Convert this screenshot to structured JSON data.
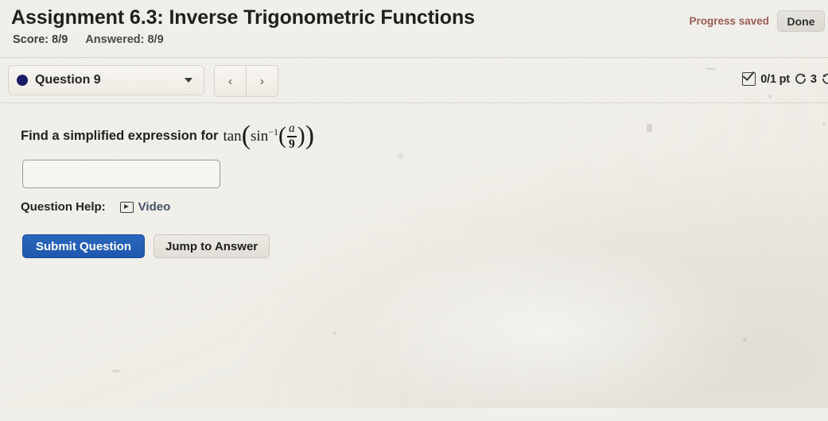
{
  "header": {
    "title": "Assignment 6.3: Inverse Trigonometric Functions",
    "score_label": "Score: 8/9",
    "answered_label": "Answered: 8/9",
    "progress_saved": "Progress saved",
    "done_label": "Done",
    "progress_saved_color": "#9a5b57"
  },
  "question_bar": {
    "selected_question": "Question 9",
    "status_dot_color": "#1b1c66",
    "dropdown_caret_icon": "chevron-down-icon",
    "prev_label": "‹",
    "next_label": "›",
    "points": "0/1 pt",
    "attempts": "3",
    "check_icon": "checkbox-checked-icon",
    "retry_icon": "circular-arrow-icon",
    "details_icon": "circular-arrow-icon"
  },
  "question": {
    "prompt_text": "Find a simplified expression for",
    "math": {
      "outer_function": "tan",
      "inner_function": "sin",
      "inner_exponent": "−1",
      "fraction_numerator": "a",
      "fraction_denominator": "9",
      "plain": "tan(sin⁻¹(a/9))"
    },
    "answer_value": "",
    "answer_placeholder": ""
  },
  "help": {
    "label": "Question Help:",
    "video_label": "Video",
    "video_icon": "video-play-icon",
    "link_color": "#44506a"
  },
  "actions": {
    "submit_label": "Submit Question",
    "jump_label": "Jump to Answer",
    "submit_color": "#1f58ae"
  }
}
